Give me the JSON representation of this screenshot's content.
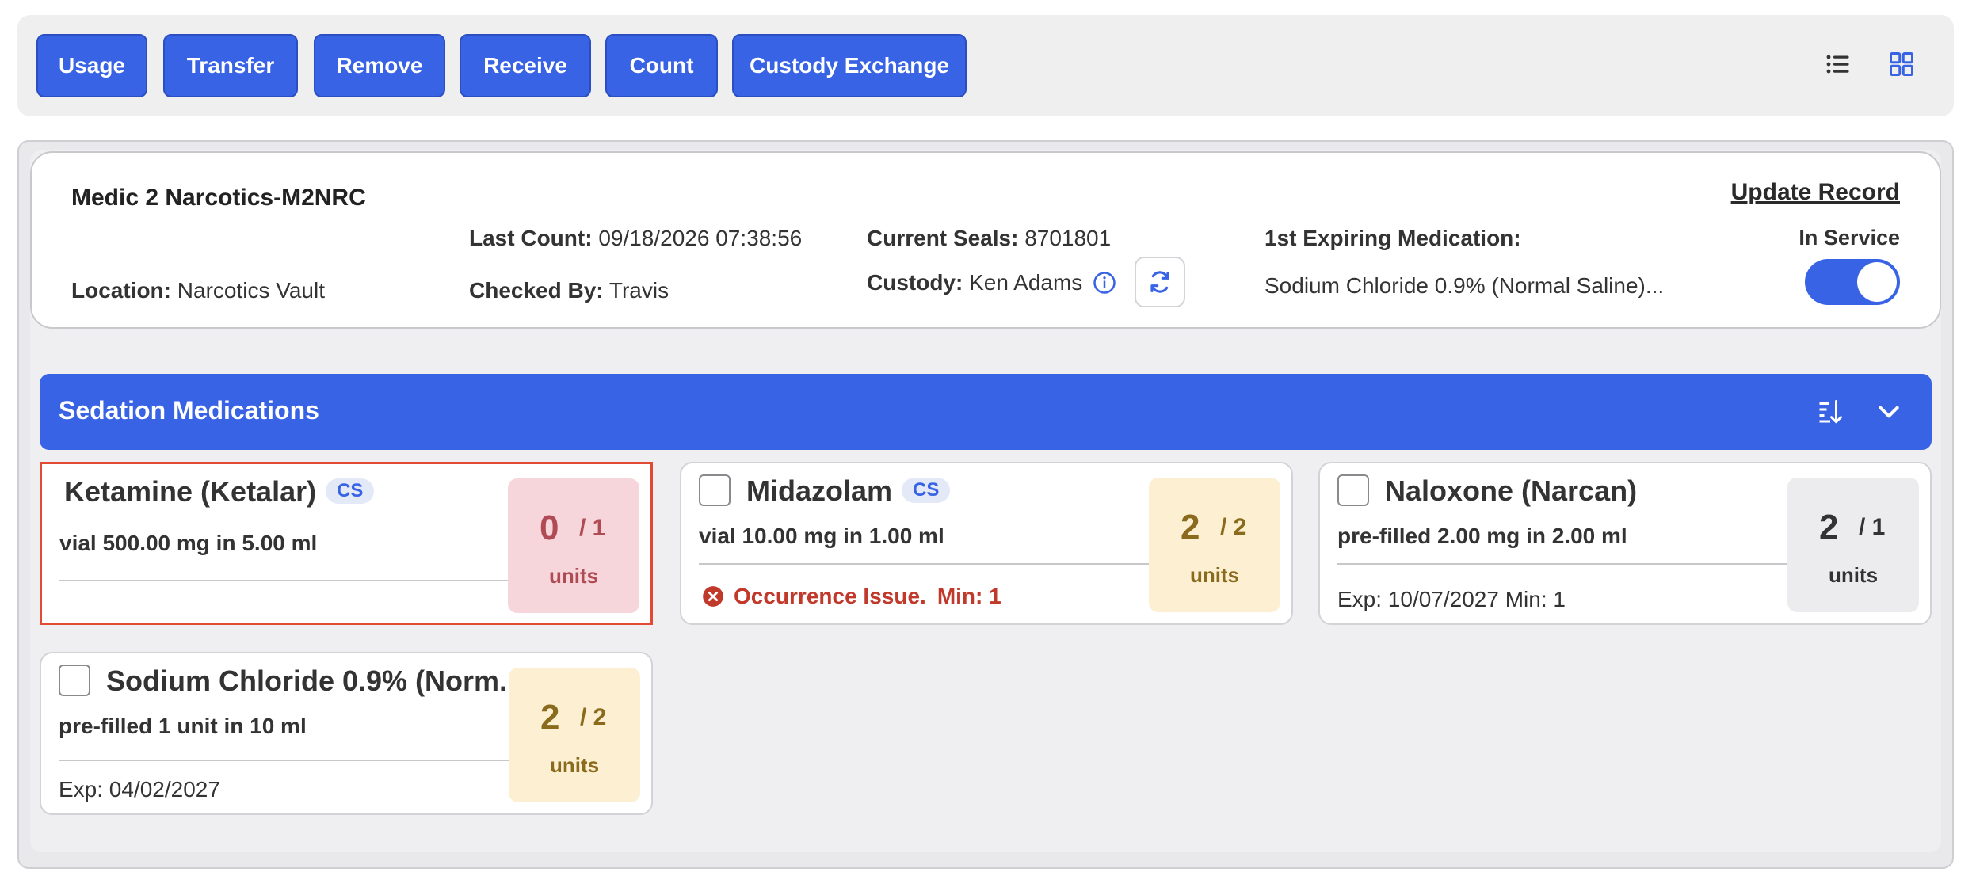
{
  "toolbar": {
    "buttons": [
      "Usage",
      "Transfer",
      "Remove",
      "Receive",
      "Count",
      "Custody Exchange"
    ],
    "view_icons": [
      "list-view-icon",
      "grid-view-icon"
    ]
  },
  "record": {
    "title": "Medic 2 Narcotics-M2NRC",
    "location_label": "Location:",
    "location_value": "Narcotics Vault",
    "last_count_label": "Last Count:",
    "last_count_value": "09/18/2026 07:38:56",
    "checked_by_label": "Checked By:",
    "checked_by_value": "Travis",
    "seals_label": "Current Seals:",
    "seals_value": "8701801",
    "custody_label": "Custody:",
    "custody_value": "Ken Adams",
    "expiring_label": "1st Expiring Medication:",
    "expiring_value": "Sodium Chloride 0.9% (Normal Saline)...",
    "update_link": "Update Record",
    "service_label": "In Service",
    "in_service": true
  },
  "category": {
    "title": "Sedation Medications",
    "accent": "#3763e4"
  },
  "medications": [
    {
      "name": "Ketamine (Ketalar)",
      "badge": "CS",
      "desc": "vial 500.00 mg in 5.00 ml",
      "footer": "",
      "count": "0",
      "total": "/ 1",
      "units": "units",
      "status_color": "#f6d6da",
      "selected": true
    },
    {
      "name": "Midazolam",
      "badge": "CS",
      "desc": "vial 10.00 mg in 1.00 ml",
      "issue": "Occurrence Issue.",
      "issue_min": "Min: 1",
      "count": "2",
      "total": "/ 2",
      "units": "units",
      "status_color": "#fdf0d2"
    },
    {
      "name": "Naloxone (Narcan)",
      "desc": "pre-filled 2.00 mg in 2.00 ml",
      "footer": "Exp: 10/07/2027 Min: 1",
      "count": "2",
      "total": "/ 1",
      "units": "units",
      "status_color": "#ececee"
    },
    {
      "name": "Sodium Chloride 0.9% (Norm...",
      "desc": "pre-filled 1 unit in 10 ml",
      "footer": "Exp: 04/02/2027",
      "count": "2",
      "total": "/ 2",
      "units": "units",
      "status_color": "#fdf0d2"
    }
  ]
}
